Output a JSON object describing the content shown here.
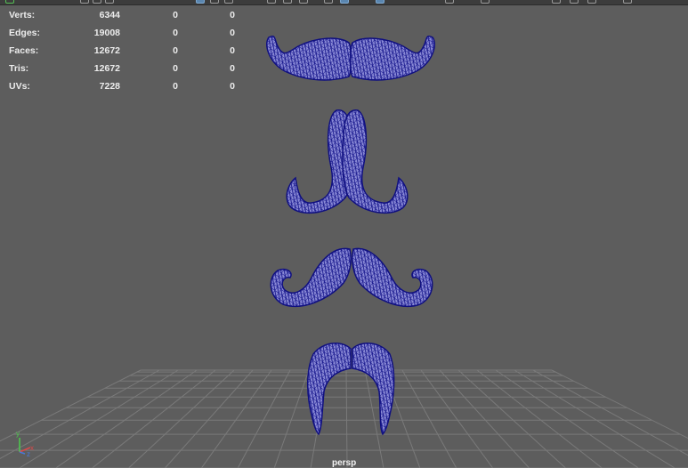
{
  "viewport": {
    "camera": "persp",
    "background_color": "#5d5d5d",
    "wireframe_color": "#101080",
    "grid_color": "#7a7a7a",
    "axis_gizmo": {
      "x_label": "x",
      "y_label": "y",
      "z_label": "z"
    }
  },
  "hud": {
    "rows": [
      {
        "label": "Verts:",
        "total": "6344",
        "selected": "0",
        "tri": "0"
      },
      {
        "label": "Edges:",
        "total": "19008",
        "selected": "0",
        "tri": "0"
      },
      {
        "label": "Faces:",
        "total": "12672",
        "selected": "0",
        "tri": "0"
      },
      {
        "label": "Tris:",
        "total": "12672",
        "selected": "0",
        "tri": "0"
      },
      {
        "label": "UVs:",
        "total": "7228",
        "selected": "0",
        "tri": "0"
      }
    ]
  },
  "models": [
    {
      "name": "mustache-handlebar",
      "icon": "mustache-wireframe"
    },
    {
      "name": "mustache-hooked",
      "icon": "mustache-wireframe"
    },
    {
      "name": "mustache-curled",
      "icon": "mustache-wireframe"
    },
    {
      "name": "mustache-horseshoe",
      "icon": "mustache-wireframe"
    }
  ]
}
